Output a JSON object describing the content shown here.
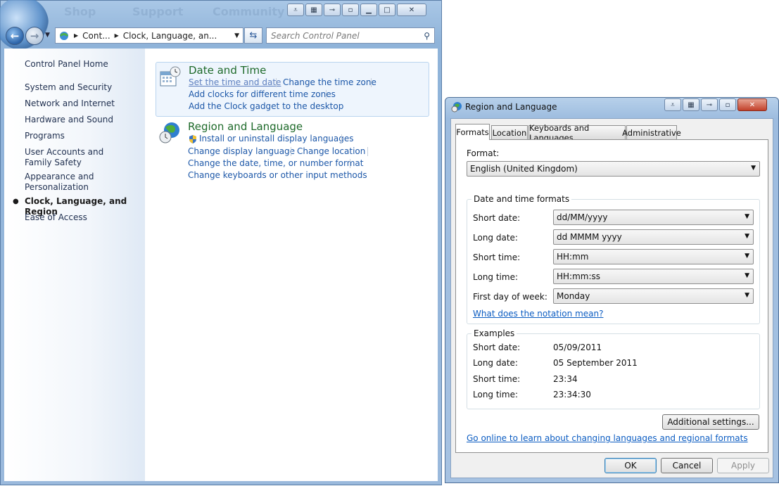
{
  "cp": {
    "ghost": [
      "Shop",
      "Support",
      "Community"
    ],
    "address": {
      "seg1": "Cont...",
      "seg2": "Clock, Language, an..."
    },
    "search_placeholder": "Search Control Panel",
    "sidebar": [
      {
        "label": "Control Panel Home"
      },
      {
        "label": "System and Security"
      },
      {
        "label": "Network and Internet"
      },
      {
        "label": "Hardware and Sound"
      },
      {
        "label": "Programs"
      },
      {
        "label": "User Accounts and Family Safety"
      },
      {
        "label": "Appearance and Personalization"
      },
      {
        "label": "Clock, Language, and Region",
        "active": true
      },
      {
        "label": "Ease of Access"
      }
    ],
    "date_time": {
      "title": "Date and Time",
      "links": [
        "Set the time and date",
        "Change the time zone",
        "Add clocks for different time zones",
        "Add the Clock gadget to the desktop"
      ]
    },
    "region": {
      "title": "Region and Language",
      "links": [
        "Install or uninstall display languages",
        "Change display language",
        "Change location",
        "Change the date, time, or number format",
        "Change keyboards or other input methods"
      ]
    }
  },
  "dialog": {
    "title": "Region and Language",
    "tabs": [
      "Formats",
      "Location",
      "Keyboards and Languages",
      "Administrative"
    ],
    "active_tab": "Formats",
    "format_label": "Format:",
    "format_value": "English (United Kingdom)",
    "dt_group_title": "Date and time formats",
    "fields": [
      {
        "label": "Short date:",
        "value": "dd/MM/yyyy"
      },
      {
        "label": "Long date:",
        "value": "dd MMMM yyyy"
      },
      {
        "label": "Short time:",
        "value": "HH:mm"
      },
      {
        "label": "Long time:",
        "value": "HH:mm:ss"
      },
      {
        "label": "First day of week:",
        "value": "Monday"
      }
    ],
    "notation_link": "What does the notation mean?",
    "examples_title": "Examples",
    "examples": [
      {
        "label": "Short date:",
        "value": "05/09/2011"
      },
      {
        "label": "Long date:",
        "value": "05 September 2011"
      },
      {
        "label": "Short time:",
        "value": "23:34"
      },
      {
        "label": "Long time:",
        "value": "23:34:30"
      }
    ],
    "additional_button": "Additional settings...",
    "online_link": "Go online to learn about changing languages and regional formats",
    "ok": "OK",
    "cancel": "Cancel",
    "apply": "Apply"
  },
  "colors": {
    "link": "#1c57a8",
    "category_title": "#1e6a2a",
    "hyperlink": "#0b5cc2"
  }
}
